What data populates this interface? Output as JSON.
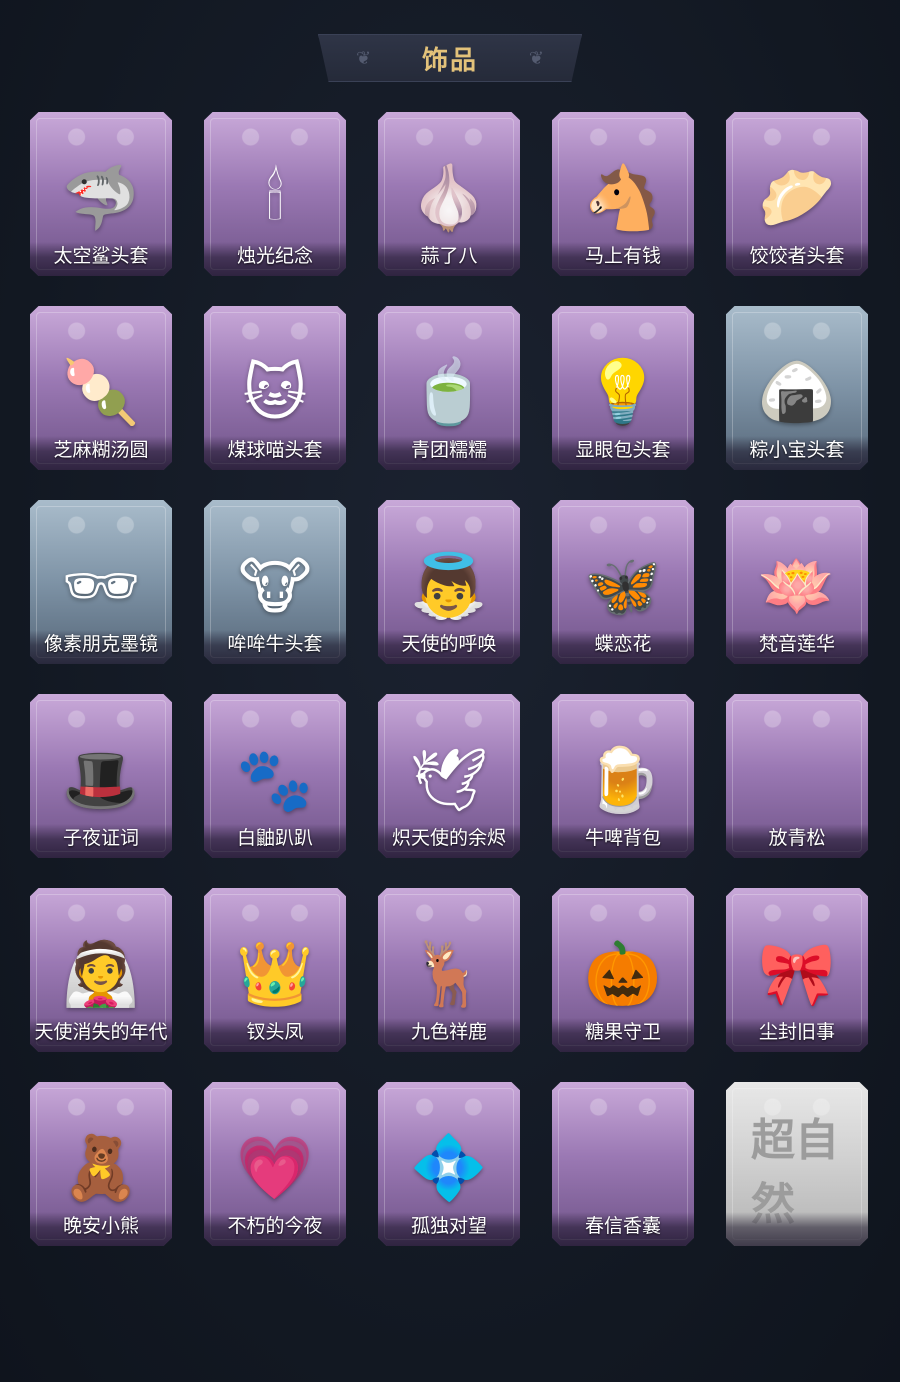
{
  "header": {
    "title": "饰品"
  },
  "colors": {
    "background": "#141a24",
    "title_text": "#e3c27a",
    "card_purple": "#9b79b4",
    "card_blue": "#7e93a6",
    "card_silver": "#cfcfcf"
  },
  "items": [
    {
      "name": "太空鲨头套",
      "icon": "shark-head-icon",
      "glyph": "🦈",
      "variant": "purple"
    },
    {
      "name": "烛光纪念",
      "icon": "candle-icon",
      "glyph": "🕯",
      "variant": "purple"
    },
    {
      "name": "蒜了八",
      "icon": "garlic-icon",
      "glyph": "🧄",
      "variant": "purple"
    },
    {
      "name": "马上有钱",
      "icon": "horse-head-icon",
      "glyph": "🐴",
      "variant": "purple"
    },
    {
      "name": "饺饺者头套",
      "icon": "dumpling-icon",
      "glyph": "🥟",
      "variant": "purple"
    },
    {
      "name": "芝麻糊汤圆",
      "icon": "rice-ball-icon",
      "glyph": "🍡",
      "variant": "purple"
    },
    {
      "name": "煤球喵头套",
      "icon": "cat-head-icon",
      "glyph": "🐱",
      "variant": "purple"
    },
    {
      "name": "青团糯糯",
      "icon": "green-bun-icon",
      "glyph": "🍵",
      "variant": "purple"
    },
    {
      "name": "显眼包头套",
      "icon": "lightbulb-icon",
      "glyph": "💡",
      "variant": "purple"
    },
    {
      "name": "粽小宝头套",
      "icon": "zongzi-icon",
      "glyph": "🍙",
      "variant": "blue"
    },
    {
      "name": "像素朋克墨镜",
      "icon": "pixel-sunglasses-icon",
      "glyph": "🕶",
      "variant": "blue"
    },
    {
      "name": "哞哞牛头套",
      "icon": "cow-head-icon",
      "glyph": "🐮",
      "variant": "blue"
    },
    {
      "name": "天使的呼唤",
      "icon": "angel-doll-icon",
      "glyph": "👼",
      "variant": "purple"
    },
    {
      "name": "蝶恋花",
      "icon": "butterfly-bell-icon",
      "glyph": "🦋",
      "variant": "purple"
    },
    {
      "name": "梵音莲华",
      "icon": "lotus-doll-icon",
      "glyph": "🪷",
      "variant": "purple"
    },
    {
      "name": "子夜证词",
      "icon": "plague-doctor-icon",
      "glyph": "🎩",
      "variant": "purple"
    },
    {
      "name": "白鼬趴趴",
      "icon": "ferret-icon",
      "glyph": "🐾",
      "variant": "purple"
    },
    {
      "name": "炽天使的余烬",
      "icon": "seraph-doll-icon",
      "glyph": "🕊",
      "variant": "purple"
    },
    {
      "name": "牛啤背包",
      "icon": "beer-barrel-icon",
      "glyph": "🍺",
      "variant": "purple"
    },
    {
      "name": "放青松",
      "icon": "empty-slot-icon",
      "glyph": "",
      "variant": "purple"
    },
    {
      "name": "天使消失的年代",
      "icon": "veiled-doll-icon",
      "glyph": "👰",
      "variant": "purple"
    },
    {
      "name": "钗头凤",
      "icon": "phoenix-crown-icon",
      "glyph": "👑",
      "variant": "purple"
    },
    {
      "name": "九色祥鹿",
      "icon": "deer-icon",
      "glyph": "🦌",
      "variant": "purple"
    },
    {
      "name": "糖果守卫",
      "icon": "pumpkin-icon",
      "glyph": "🎃",
      "variant": "purple"
    },
    {
      "name": "尘封旧事",
      "icon": "gentleman-doll-icon",
      "glyph": "🎀",
      "variant": "purple"
    },
    {
      "name": "晚安小熊",
      "icon": "bear-icon",
      "glyph": "🧸",
      "variant": "purple"
    },
    {
      "name": "不朽的今夜",
      "icon": "pink-cat-bowl-icon",
      "glyph": "💗",
      "variant": "purple"
    },
    {
      "name": "孤独对望",
      "icon": "lady-charm-icon",
      "glyph": "💠",
      "variant": "purple"
    },
    {
      "name": "春信香囊",
      "icon": "empty-slot-icon",
      "glyph": "",
      "variant": "purple"
    },
    {
      "name": "",
      "icon": "chaoziran-logo-icon",
      "glyph": "超自然",
      "variant": "silver"
    }
  ]
}
